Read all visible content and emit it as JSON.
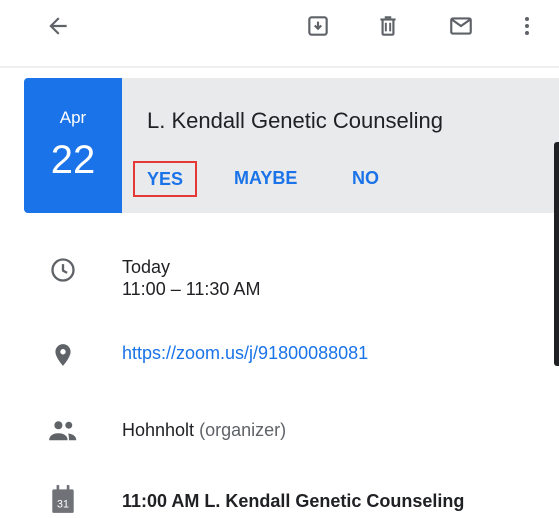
{
  "toolbar": {
    "back_icon": "arrow-back-icon",
    "archive_icon": "archive-icon",
    "delete_icon": "trash-icon",
    "mail_icon": "mail-icon",
    "more_icon": "more-vert-icon"
  },
  "event": {
    "month": "Apr",
    "day": "22",
    "title": "L. Kendall Genetic Counseling",
    "rsvp": {
      "yes": "YES",
      "maybe": "MAYBE",
      "no": "NO"
    }
  },
  "details": {
    "when": {
      "day": "Today",
      "time": "11:00 – 11:30 AM"
    },
    "location": {
      "link": "https://zoom.us/j/91800088081"
    },
    "organizer": {
      "name": "Hohnholt",
      "role": "(organizer)"
    },
    "agenda": {
      "calendar_day": "31",
      "text": "11:00 AM  L. Kendall Genetic Counseling"
    }
  },
  "colors": {
    "accent": "#1a73e8",
    "card_bg": "#e9eaec",
    "highlight_border": "#e53935",
    "icon_gray": "#5f6368"
  }
}
